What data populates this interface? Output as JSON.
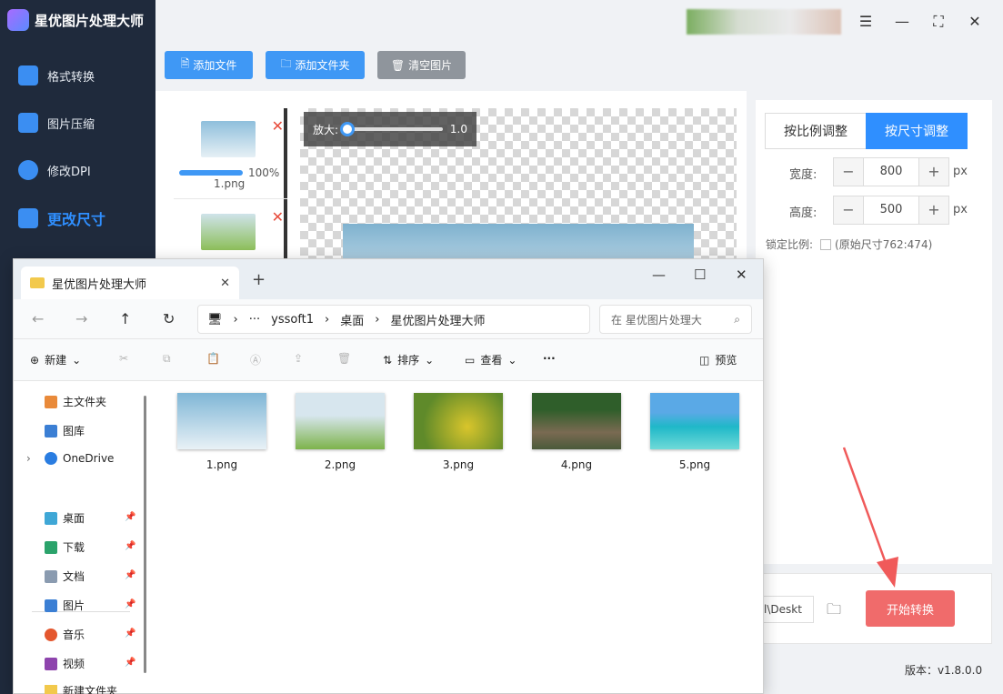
{
  "app": {
    "title": "星优图片处理大师",
    "sidebar": [
      {
        "label": "格式转换"
      },
      {
        "label": "图片压缩"
      },
      {
        "label": "修改DPI"
      },
      {
        "label": "更改尺寸"
      }
    ],
    "toolbar": {
      "add_file": "添加文件",
      "add_folder": "添加文件夹",
      "clear": "清空图片"
    },
    "thumbs": [
      {
        "name": "1.png",
        "progress": "100%"
      },
      {
        "name": ""
      }
    ],
    "zoom": {
      "label": "放大:",
      "value": "1.0"
    },
    "resize": {
      "tab_ratio": "按比例调整",
      "tab_size": "按尺寸调整",
      "width_label": "宽度:",
      "width_value": "800",
      "height_label": "高度:",
      "height_value": "500",
      "unit": "px",
      "lock_label": "锁定比例:",
      "original_size": "(原始尺寸762:474)",
      "minus": "−",
      "plus": "+"
    },
    "output_path": "l\\Deskt",
    "start_button": "开始转换",
    "version": "版本：v1.8.0.0",
    "colors": {
      "accent": "#2f8fff",
      "start": "#f06b6b",
      "sidebar": "#1f2a3c"
    }
  },
  "explorer": {
    "tab_title": "星优图片处理大师",
    "breadcrumbs": [
      "yssoft1",
      "桌面",
      "星优图片处理大师"
    ],
    "search_placeholder": "在 星优图片处理大",
    "commands": {
      "new": "新建",
      "sort": "排序",
      "view": "查看",
      "preview": "预览",
      "more": "···"
    },
    "nav": [
      {
        "label": "主文件夹"
      },
      {
        "label": "图库"
      },
      {
        "label": "OneDrive"
      },
      {
        "label": "桌面"
      },
      {
        "label": "下载"
      },
      {
        "label": "文档"
      },
      {
        "label": "图片"
      },
      {
        "label": "音乐"
      },
      {
        "label": "视频"
      },
      {
        "label": "新建文件夹"
      }
    ],
    "files": [
      {
        "name": "1.png"
      },
      {
        "name": "2.png"
      },
      {
        "name": "3.png"
      },
      {
        "name": "4.png"
      },
      {
        "name": "5.png"
      }
    ]
  }
}
